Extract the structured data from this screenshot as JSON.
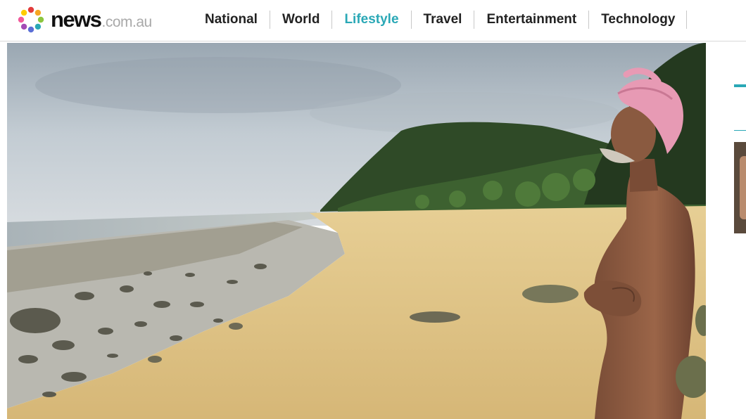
{
  "header": {
    "logo": {
      "text": "news",
      "domain": ".com.au"
    },
    "nav": [
      {
        "label": "National",
        "active": false
      },
      {
        "label": "World",
        "active": false
      },
      {
        "label": "Lifestyle",
        "active": true
      },
      {
        "label": "Travel",
        "active": false
      },
      {
        "label": "Entertainment",
        "active": false
      },
      {
        "label": "Technology",
        "active": false
      }
    ]
  },
  "colors": {
    "accent": "#2aa8b6",
    "nav_text": "#222222",
    "logo_domain": "#a9a9a9",
    "logo_dots": [
      "#e23b3b",
      "#f5a623",
      "#8cc63f",
      "#2aa8b6",
      "#5b6fd6",
      "#a44bb5",
      "#f15a9b",
      "#ffcc00"
    ]
  }
}
